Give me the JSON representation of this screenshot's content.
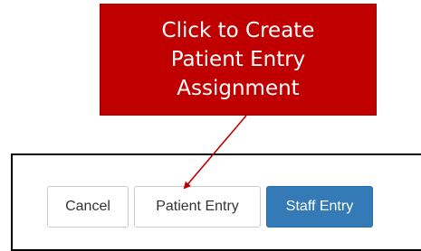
{
  "callout": {
    "lines": [
      "Click to Create",
      "Patient Entry",
      "Assignment"
    ],
    "background_color": "#c00000",
    "text_color": "#ffffff",
    "arrow_color": "#c00000"
  },
  "dialog": {
    "buttons": {
      "cancel_label": "Cancel",
      "patient_entry_label": "Patient Entry",
      "staff_entry_label": "Staff Entry"
    },
    "primary_color": "#337ab7"
  }
}
